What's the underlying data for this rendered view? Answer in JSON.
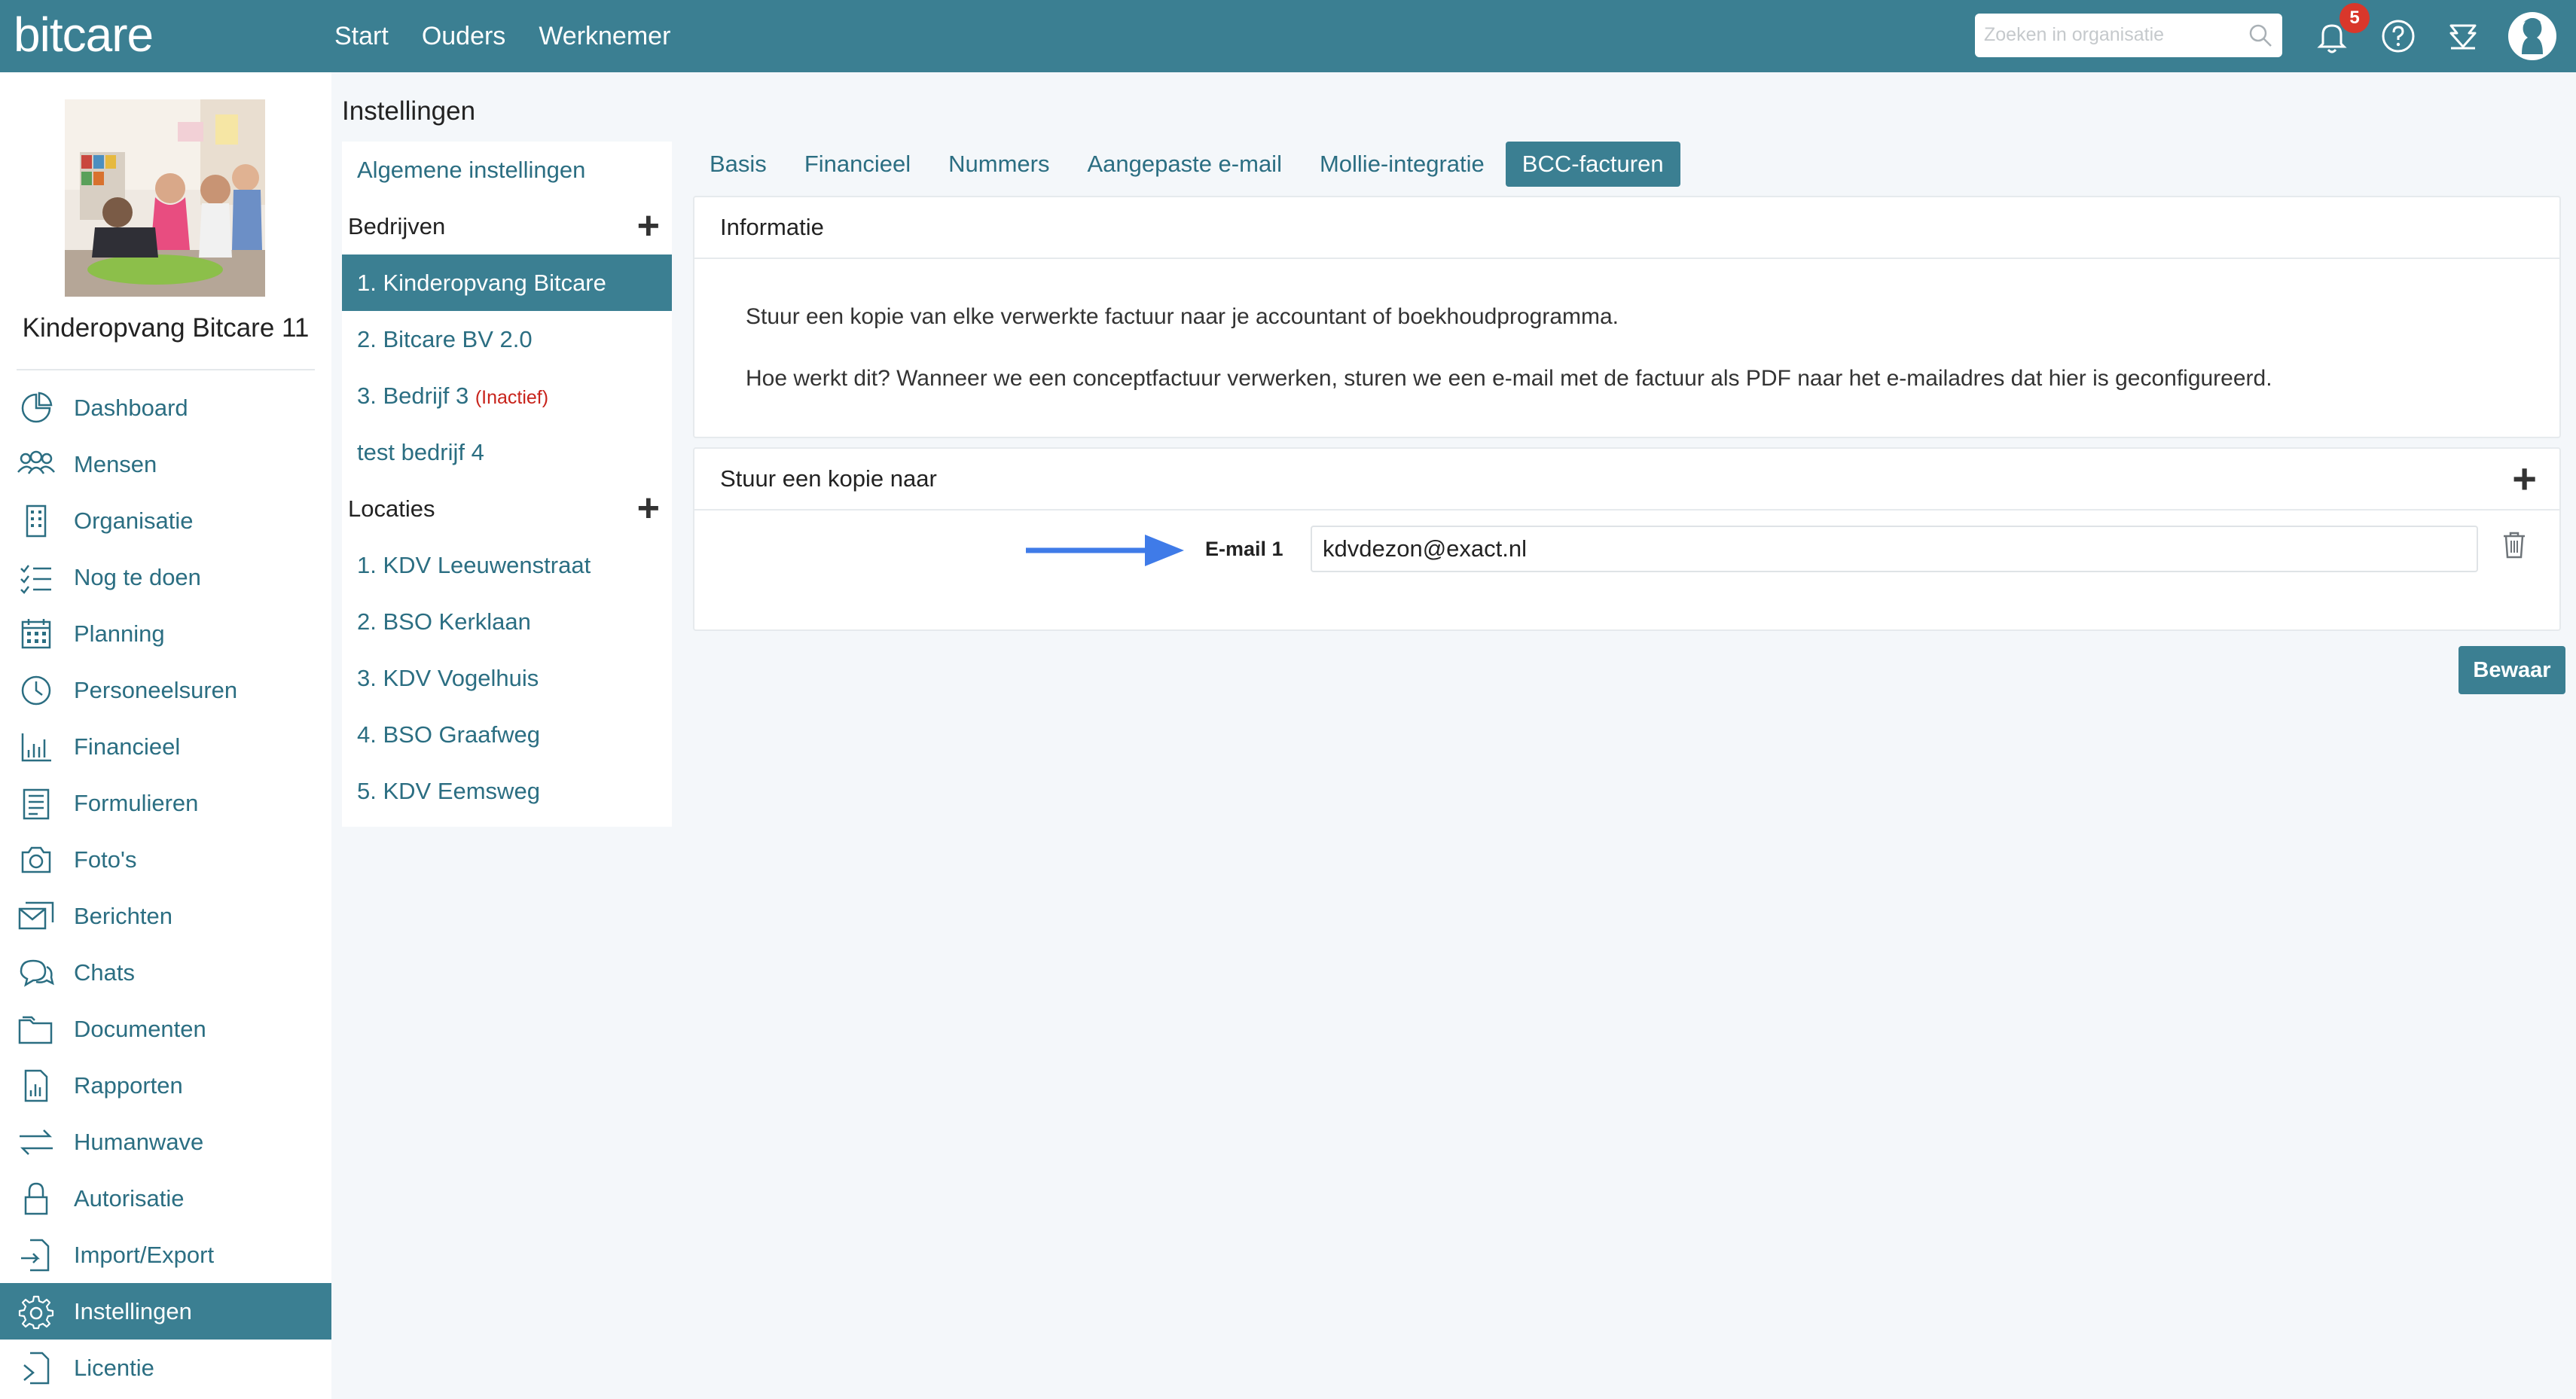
{
  "app": {
    "logo": "bitcare"
  },
  "topnav": [
    "Start",
    "Ouders",
    "Werknemer"
  ],
  "search": {
    "placeholder": "Zoeken in organisatie",
    "value": ""
  },
  "notifications": {
    "count": "5"
  },
  "organization": {
    "name": "Kinderopvang Bitcare 11"
  },
  "sidebar": {
    "items": [
      {
        "label": "Dashboard",
        "icon": "dashboard-icon"
      },
      {
        "label": "Mensen",
        "icon": "people-icon"
      },
      {
        "label": "Organisatie",
        "icon": "building-icon"
      },
      {
        "label": "Nog te doen",
        "icon": "checklist-icon"
      },
      {
        "label": "Planning",
        "icon": "calendar-icon"
      },
      {
        "label": "Personeelsuren",
        "icon": "clock-icon"
      },
      {
        "label": "Financieel",
        "icon": "bar-chart-icon"
      },
      {
        "label": "Formulieren",
        "icon": "form-icon"
      },
      {
        "label": "Foto's",
        "icon": "camera-icon"
      },
      {
        "label": "Berichten",
        "icon": "messages-icon"
      },
      {
        "label": "Chats",
        "icon": "chat-icon"
      },
      {
        "label": "Documenten",
        "icon": "folder-icon"
      },
      {
        "label": "Rapporten",
        "icon": "report-icon"
      },
      {
        "label": "Humanwave",
        "icon": "transfer-icon"
      },
      {
        "label": "Autorisatie",
        "icon": "lock-icon"
      },
      {
        "label": "Import/Export",
        "icon": "import-export-icon"
      },
      {
        "label": "Instellingen",
        "icon": "gear-icon"
      },
      {
        "label": "Licentie",
        "icon": "license-icon"
      }
    ],
    "active": "Instellingen"
  },
  "settings": {
    "title": "Instellingen",
    "general": "Algemene instellingen",
    "companies_header": "Bedrijven",
    "companies": [
      {
        "label": "1. Kinderopvang Bitcare",
        "status": ""
      },
      {
        "label": "2. Bitcare BV 2.0",
        "status": ""
      },
      {
        "label": "3. Bedrijf 3",
        "status": "(Inactief)"
      },
      {
        "label": "test bedrijf 4",
        "status": ""
      }
    ],
    "locations_header": "Locaties",
    "locations": [
      "1. KDV Leeuwenstraat",
      "2. BSO Kerklaan",
      "3. KDV Vogelhuis",
      "4. BSO Graafweg",
      "5. KDV Eemsweg"
    ]
  },
  "tabs": [
    "Basis",
    "Financieel",
    "Nummers",
    "Aangepaste e-mail",
    "Mollie-integratie",
    "BCC-facturen"
  ],
  "active_tab": "BCC-facturen",
  "info": {
    "header": "Informatie",
    "line1": "Stuur een kopie van elke verwerkte factuur naar je accountant of boekhoudprogramma.",
    "line2": "Hoe werkt dit? Wanneer we een conceptfactuur verwerken, sturen we een e-mail met de factuur als PDF naar het e-mailadres dat hier is geconfigureerd."
  },
  "copy": {
    "header": "Stuur een kopie naar",
    "email_label": "E-mail 1",
    "email_value": "kdvdezon@exact.nl"
  },
  "save_label": "Bewaar",
  "colors": {
    "primary": "#3b7f92",
    "link": "#2b6e82",
    "badge": "#d9372b",
    "inactive": "#c8231b",
    "arrow": "#3f7be8"
  }
}
